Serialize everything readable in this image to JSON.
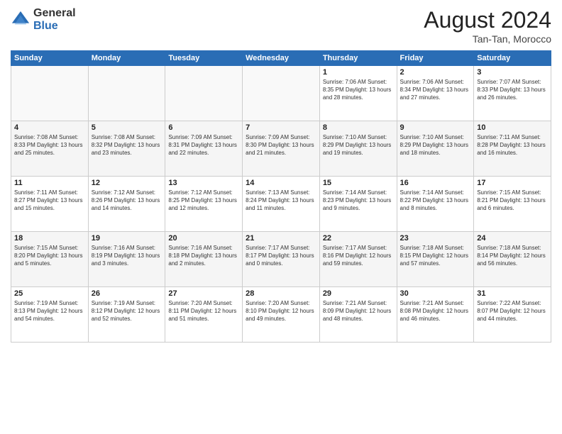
{
  "header": {
    "logo_general": "General",
    "logo_blue": "Blue",
    "month_year": "August 2024",
    "location": "Tan-Tan, Morocco"
  },
  "days_of_week": [
    "Sunday",
    "Monday",
    "Tuesday",
    "Wednesday",
    "Thursday",
    "Friday",
    "Saturday"
  ],
  "weeks": [
    [
      {
        "day": "",
        "info": ""
      },
      {
        "day": "",
        "info": ""
      },
      {
        "day": "",
        "info": ""
      },
      {
        "day": "",
        "info": ""
      },
      {
        "day": "1",
        "info": "Sunrise: 7:06 AM\nSunset: 8:35 PM\nDaylight: 13 hours\nand 28 minutes."
      },
      {
        "day": "2",
        "info": "Sunrise: 7:06 AM\nSunset: 8:34 PM\nDaylight: 13 hours\nand 27 minutes."
      },
      {
        "day": "3",
        "info": "Sunrise: 7:07 AM\nSunset: 8:33 PM\nDaylight: 13 hours\nand 26 minutes."
      }
    ],
    [
      {
        "day": "4",
        "info": "Sunrise: 7:08 AM\nSunset: 8:33 PM\nDaylight: 13 hours\nand 25 minutes."
      },
      {
        "day": "5",
        "info": "Sunrise: 7:08 AM\nSunset: 8:32 PM\nDaylight: 13 hours\nand 23 minutes."
      },
      {
        "day": "6",
        "info": "Sunrise: 7:09 AM\nSunset: 8:31 PM\nDaylight: 13 hours\nand 22 minutes."
      },
      {
        "day": "7",
        "info": "Sunrise: 7:09 AM\nSunset: 8:30 PM\nDaylight: 13 hours\nand 21 minutes."
      },
      {
        "day": "8",
        "info": "Sunrise: 7:10 AM\nSunset: 8:29 PM\nDaylight: 13 hours\nand 19 minutes."
      },
      {
        "day": "9",
        "info": "Sunrise: 7:10 AM\nSunset: 8:29 PM\nDaylight: 13 hours\nand 18 minutes."
      },
      {
        "day": "10",
        "info": "Sunrise: 7:11 AM\nSunset: 8:28 PM\nDaylight: 13 hours\nand 16 minutes."
      }
    ],
    [
      {
        "day": "11",
        "info": "Sunrise: 7:11 AM\nSunset: 8:27 PM\nDaylight: 13 hours\nand 15 minutes."
      },
      {
        "day": "12",
        "info": "Sunrise: 7:12 AM\nSunset: 8:26 PM\nDaylight: 13 hours\nand 14 minutes."
      },
      {
        "day": "13",
        "info": "Sunrise: 7:12 AM\nSunset: 8:25 PM\nDaylight: 13 hours\nand 12 minutes."
      },
      {
        "day": "14",
        "info": "Sunrise: 7:13 AM\nSunset: 8:24 PM\nDaylight: 13 hours\nand 11 minutes."
      },
      {
        "day": "15",
        "info": "Sunrise: 7:14 AM\nSunset: 8:23 PM\nDaylight: 13 hours\nand 9 minutes."
      },
      {
        "day": "16",
        "info": "Sunrise: 7:14 AM\nSunset: 8:22 PM\nDaylight: 13 hours\nand 8 minutes."
      },
      {
        "day": "17",
        "info": "Sunrise: 7:15 AM\nSunset: 8:21 PM\nDaylight: 13 hours\nand 6 minutes."
      }
    ],
    [
      {
        "day": "18",
        "info": "Sunrise: 7:15 AM\nSunset: 8:20 PM\nDaylight: 13 hours\nand 5 minutes."
      },
      {
        "day": "19",
        "info": "Sunrise: 7:16 AM\nSunset: 8:19 PM\nDaylight: 13 hours\nand 3 minutes."
      },
      {
        "day": "20",
        "info": "Sunrise: 7:16 AM\nSunset: 8:18 PM\nDaylight: 13 hours\nand 2 minutes."
      },
      {
        "day": "21",
        "info": "Sunrise: 7:17 AM\nSunset: 8:17 PM\nDaylight: 13 hours\nand 0 minutes."
      },
      {
        "day": "22",
        "info": "Sunrise: 7:17 AM\nSunset: 8:16 PM\nDaylight: 12 hours\nand 59 minutes."
      },
      {
        "day": "23",
        "info": "Sunrise: 7:18 AM\nSunset: 8:15 PM\nDaylight: 12 hours\nand 57 minutes."
      },
      {
        "day": "24",
        "info": "Sunrise: 7:18 AM\nSunset: 8:14 PM\nDaylight: 12 hours\nand 56 minutes."
      }
    ],
    [
      {
        "day": "25",
        "info": "Sunrise: 7:19 AM\nSunset: 8:13 PM\nDaylight: 12 hours\nand 54 minutes."
      },
      {
        "day": "26",
        "info": "Sunrise: 7:19 AM\nSunset: 8:12 PM\nDaylight: 12 hours\nand 52 minutes."
      },
      {
        "day": "27",
        "info": "Sunrise: 7:20 AM\nSunset: 8:11 PM\nDaylight: 12 hours\nand 51 minutes."
      },
      {
        "day": "28",
        "info": "Sunrise: 7:20 AM\nSunset: 8:10 PM\nDaylight: 12 hours\nand 49 minutes."
      },
      {
        "day": "29",
        "info": "Sunrise: 7:21 AM\nSunset: 8:09 PM\nDaylight: 12 hours\nand 48 minutes."
      },
      {
        "day": "30",
        "info": "Sunrise: 7:21 AM\nSunset: 8:08 PM\nDaylight: 12 hours\nand 46 minutes."
      },
      {
        "day": "31",
        "info": "Sunrise: 7:22 AM\nSunset: 8:07 PM\nDaylight: 12 hours\nand 44 minutes."
      }
    ]
  ]
}
